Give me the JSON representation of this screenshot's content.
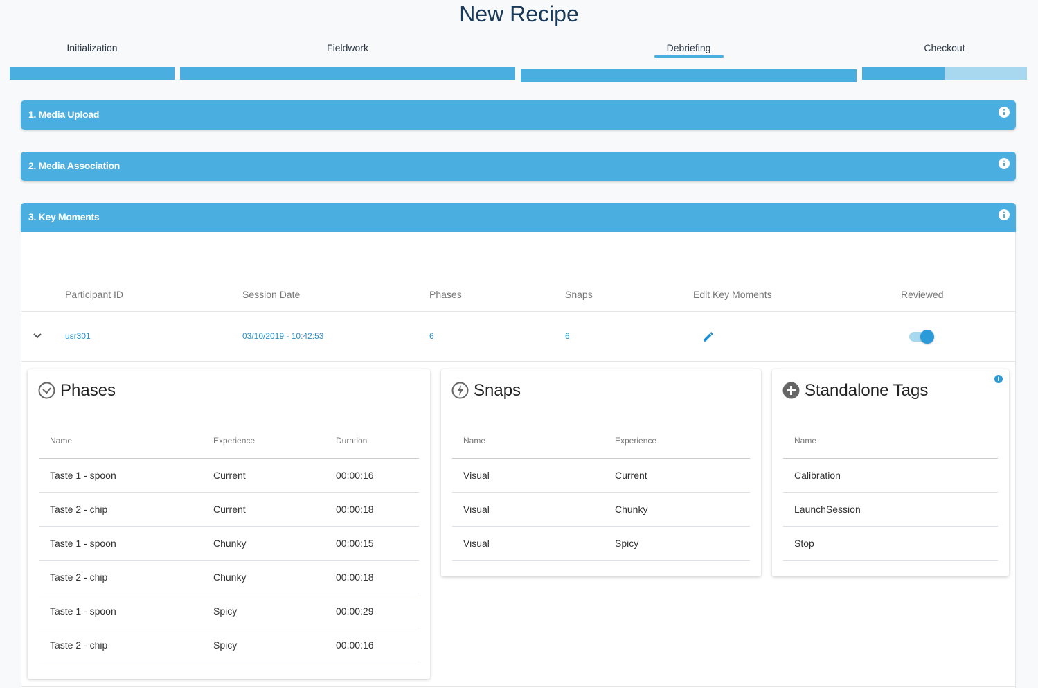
{
  "page": {
    "title": "New Recipe"
  },
  "steps": {
    "items": [
      {
        "label": "Initialization"
      },
      {
        "label": "Fieldwork"
      },
      {
        "label": "Debriefing"
      },
      {
        "label": "Checkout"
      }
    ],
    "active_step": "Debriefing",
    "checkout_progress": 0.5
  },
  "accordions": [
    {
      "title": "1. Media Upload",
      "icon": "info-icon"
    },
    {
      "title": "2. Media Association",
      "icon": "info-icon"
    },
    {
      "title": "3. Key Moments",
      "icon": "info-icon"
    }
  ],
  "key_moments": {
    "columns": [
      "Participant ID",
      "Session Date",
      "Phases",
      "Snaps",
      "Edit Key Moments",
      "Reviewed"
    ],
    "row": {
      "participant_id": "usr301",
      "session_date": "03/10/2019 - 10:42:53",
      "phases": "6",
      "snaps": "6",
      "edit_icon": "pencil-icon",
      "reviewed": true
    }
  },
  "phases_card": {
    "title": "Phases",
    "icon": "clock-icon",
    "columns": [
      "Name",
      "Experience",
      "Duration"
    ],
    "rows": [
      [
        "Taste 1 - spoon",
        "Current",
        "00:00:16"
      ],
      [
        "Taste 2 - chip",
        "Current",
        "00:00:18"
      ],
      [
        "Taste 1 - spoon",
        "Chunky",
        "00:00:15"
      ],
      [
        "Taste 2 - chip",
        "Chunky",
        "00:00:18"
      ],
      [
        "Taste 1 - spoon",
        "Spicy",
        "00:00:29"
      ],
      [
        "Taste 2 - chip",
        "Spicy",
        "00:00:16"
      ]
    ]
  },
  "snaps_card": {
    "title": "Snaps",
    "icon": "lightning-icon",
    "columns": [
      "Name",
      "Experience"
    ],
    "rows": [
      [
        "Visual",
        "Current"
      ],
      [
        "Visual",
        "Chunky"
      ],
      [
        "Visual",
        "Spicy"
      ]
    ]
  },
  "tags_card": {
    "title": "Standalone Tags",
    "icon": "plus-circle-icon",
    "info_icon": "info-icon",
    "columns": [
      "Name"
    ],
    "rows": [
      [
        "Calibration"
      ],
      [
        "LaunchSession"
      ],
      [
        "Stop"
      ]
    ]
  },
  "colors": {
    "accent": "#4aafe0",
    "accent_light": "#a7d8f0",
    "link": "#2a8fcb",
    "title": "#1a3a5c"
  }
}
